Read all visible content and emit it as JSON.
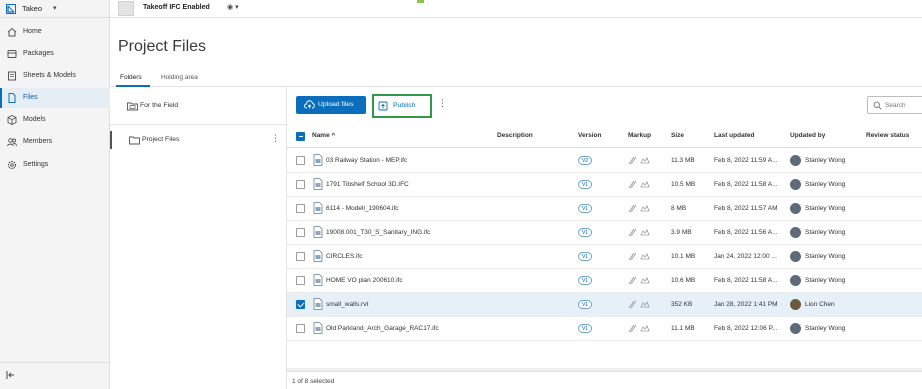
{
  "app": {
    "name": "Takeo"
  },
  "nav": {
    "items": [
      {
        "label": "Home",
        "icon": "home-icon"
      },
      {
        "label": "Packages",
        "icon": "package-icon"
      },
      {
        "label": "Sheets & Models",
        "icon": "sheets-icon"
      },
      {
        "label": "Files",
        "icon": "file-icon",
        "active": true
      },
      {
        "label": "Models",
        "icon": "cube-icon"
      },
      {
        "label": "Members",
        "icon": "members-icon"
      },
      {
        "label": "Settings",
        "icon": "gear-icon"
      }
    ]
  },
  "project": {
    "name": "Takeoff IFC Enabled"
  },
  "page": {
    "title": "Project Files",
    "tabs": [
      {
        "label": "Folders",
        "active": true
      },
      {
        "label": "Holding area"
      }
    ]
  },
  "tree": {
    "items": [
      {
        "label": "For the Field"
      },
      {
        "label": "Project Files",
        "selected": true
      }
    ]
  },
  "toolbar": {
    "upload_label": "Upload files",
    "publish_label": "Publish",
    "search_placeholder": "Search"
  },
  "table": {
    "columns": {
      "name": "Name ^",
      "description": "Description",
      "version": "Version",
      "markup": "Markup",
      "size": "Size",
      "last_updated": "Last updated",
      "updated_by": "Updated by",
      "review_status": "Review status"
    },
    "rows": [
      {
        "name": "03 Railway Station - MEP.ifc",
        "version": "V2",
        "size": "11.3 MB",
        "updated": "Feb 8, 2022 11:59 A...",
        "by": "Stanley Wong",
        "checked": false
      },
      {
        "name": "1791 Tibshelf School 3D.IFC",
        "version": "V1",
        "size": "10.5 MB",
        "updated": "Feb 8, 2022 11:58 A...",
        "by": "Stanley Wong",
        "checked": false
      },
      {
        "name": "6114 - Modell_190604.ifc",
        "version": "V1",
        "size": "8 MB",
        "updated": "Feb 8, 2022 11:57 AM",
        "by": "Stanley Wong",
        "checked": false
      },
      {
        "name": "19008.001_T30_S_Sanitary_ING.ifc",
        "version": "V1",
        "size": "3.9 MB",
        "updated": "Feb 8, 2022 11:56 A...",
        "by": "Stanley Wong",
        "checked": false
      },
      {
        "name": "CIRCLES.ifc",
        "version": "V1",
        "size": "10.1 MB",
        "updated": "Jan 24, 2022 12:00 ...",
        "by": "Stanley Wong",
        "checked": false
      },
      {
        "name": "HOME VO plan 200610.ifc",
        "version": "V1",
        "size": "10.6 MB",
        "updated": "Feb 8, 2022 11:58 A...",
        "by": "Stanley Wong",
        "checked": false
      },
      {
        "name": "small_walls.rvt",
        "version": "V1",
        "size": "352 KB",
        "updated": "Jan 28, 2022 1:41 PM",
        "by": "Lion Chen",
        "checked": true
      },
      {
        "name": "Old Parkland_Arch_Garage_RAC17.ifc",
        "version": "V1",
        "size": "11.1 MB",
        "updated": "Feb 8, 2022 12:06 P...",
        "by": "Stanley Wong",
        "checked": false
      }
    ]
  },
  "footer": {
    "selection": "1 of 8 selected"
  },
  "colors": {
    "accent": "#0a6ebd",
    "publish_highlight": "#2e9a47",
    "selected_row": "#e6f0f8"
  }
}
